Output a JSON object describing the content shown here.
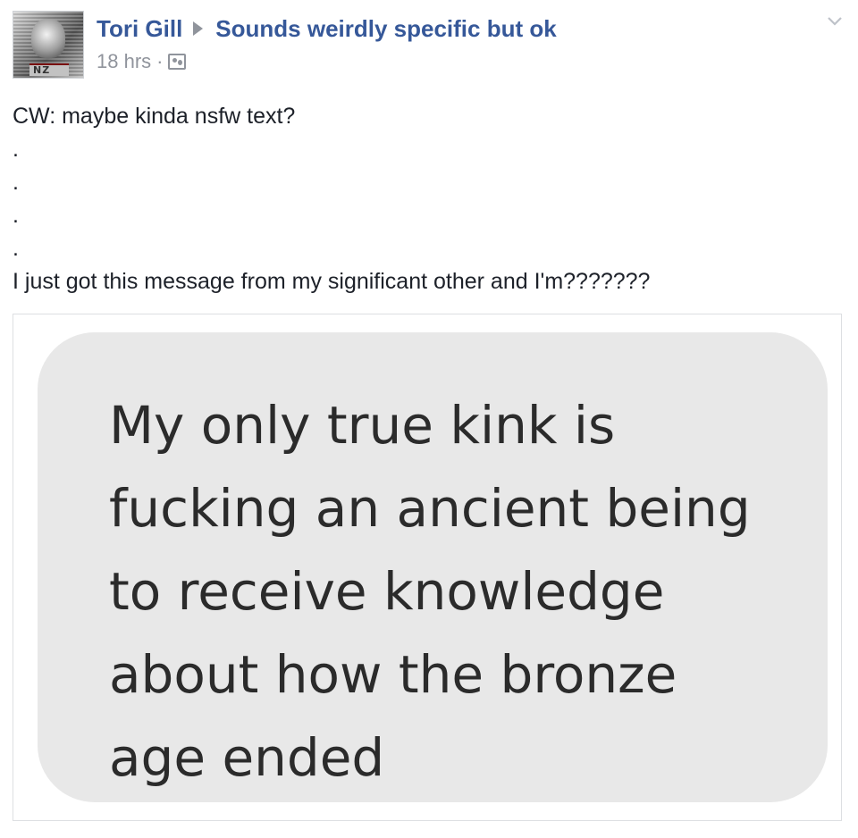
{
  "post": {
    "author": "Tori Gill",
    "group": "Sounds weirdly specific but ok",
    "timestamp": "18 hrs",
    "meta_separator": "·",
    "audience_icon": "group-members-icon",
    "avatar_tag": "NZ",
    "body_lines": [
      "CW: maybe kinda nsfw text?",
      ".",
      ".",
      ".",
      ".",
      "I just got this message from my significant other and I'm???????"
    ]
  },
  "attachment": {
    "message_lines": [
      "My only true kink is",
      "fucking an ancient being",
      "to receive knowledge",
      "about how the bronze",
      "age ended"
    ]
  },
  "colors": {
    "link": "#365899",
    "meta": "#90949c",
    "text": "#1d2129",
    "bubble": "#e8e8e8"
  }
}
